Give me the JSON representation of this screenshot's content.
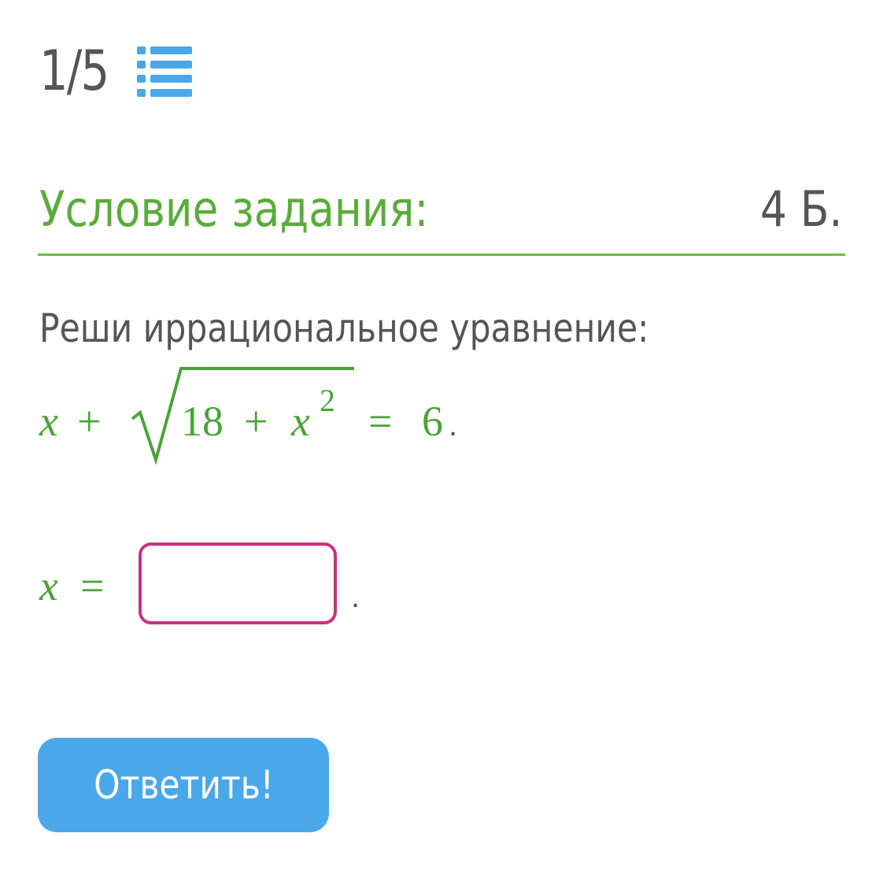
{
  "header": {
    "counter": "1/5",
    "list_icon": "list-icon"
  },
  "task": {
    "title": "Условие задания:",
    "points": "4 Б.",
    "instruction": "Реши иррациональное уравнение:"
  },
  "equation": {
    "lhs_var": "x",
    "plus": "+",
    "radicand_num": "18",
    "radicand_plus": "+",
    "radicand_var": "x",
    "exponent": "2",
    "equals": "=",
    "rhs": "6",
    "period": "."
  },
  "answer": {
    "var": "x",
    "equals": "=",
    "value": "",
    "placeholder": "",
    "trailing": "."
  },
  "submit": {
    "label": "Ответить!"
  },
  "colors": {
    "green": "#5aac3a",
    "gray": "#555555",
    "blue": "#4aa8ea",
    "input_border": "#c8337f"
  }
}
